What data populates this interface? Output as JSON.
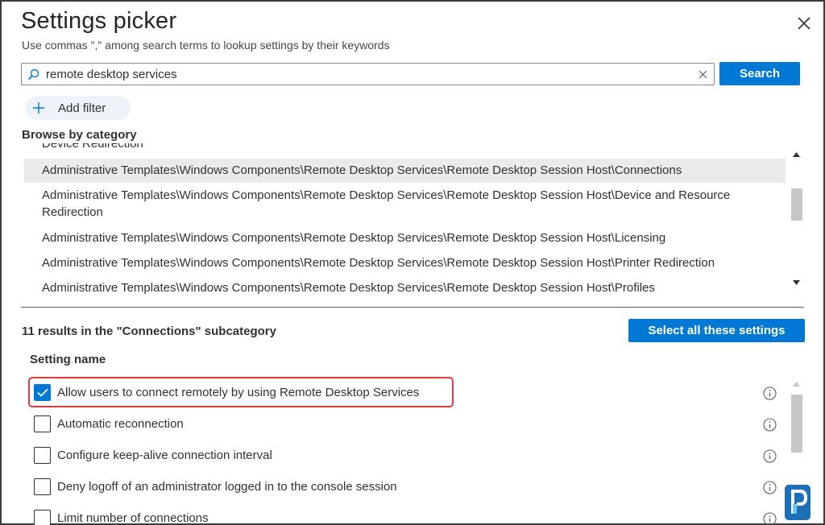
{
  "dialog": {
    "title": "Settings picker",
    "subtitle": "Use commas \",\" among search terms to lookup settings by their keywords"
  },
  "search": {
    "value": "remote desktop services",
    "button_label": "Search"
  },
  "filter": {
    "add_label": "Add filter"
  },
  "browse": {
    "heading": "Browse by category",
    "items": [
      {
        "label": "Device Redirection",
        "partial": true
      },
      {
        "label": "Administrative Templates\\Windows Components\\Remote Desktop Services\\Remote Desktop Session Host\\Connections",
        "selected": true
      },
      {
        "label": "Administrative Templates\\Windows Components\\Remote Desktop Services\\Remote Desktop Session Host\\Device and Resource Redirection"
      },
      {
        "label": "Administrative Templates\\Windows Components\\Remote Desktop Services\\Remote Desktop Session Host\\Licensing"
      },
      {
        "label": "Administrative Templates\\Windows Components\\Remote Desktop Services\\Remote Desktop Session Host\\Printer Redirection"
      },
      {
        "label": "Administrative Templates\\Windows Components\\Remote Desktop Services\\Remote Desktop Session Host\\Profiles"
      }
    ]
  },
  "results": {
    "summary": "11 results in the \"Connections\" subcategory",
    "select_all_label": "Select all these settings",
    "column_header": "Setting name",
    "settings": [
      {
        "name": "Allow users to connect remotely by using Remote Desktop Services",
        "checked": true
      },
      {
        "name": "Automatic reconnection",
        "checked": false
      },
      {
        "name": "Configure keep-alive connection interval",
        "checked": false
      },
      {
        "name": "Deny logoff of an administrator logged in to the console session",
        "checked": false
      },
      {
        "name": "Limit number of connections",
        "checked": false
      }
    ]
  },
  "colors": {
    "accent": "#0078d4",
    "highlight": "#e0393e",
    "selected_row": "#edebe9"
  },
  "icons": {
    "close": "close-icon",
    "search": "search-icon",
    "clear": "clear-icon",
    "add": "plus-icon",
    "info": "info-icon",
    "check": "checkmark-icon",
    "logo": "watermark-logo"
  }
}
